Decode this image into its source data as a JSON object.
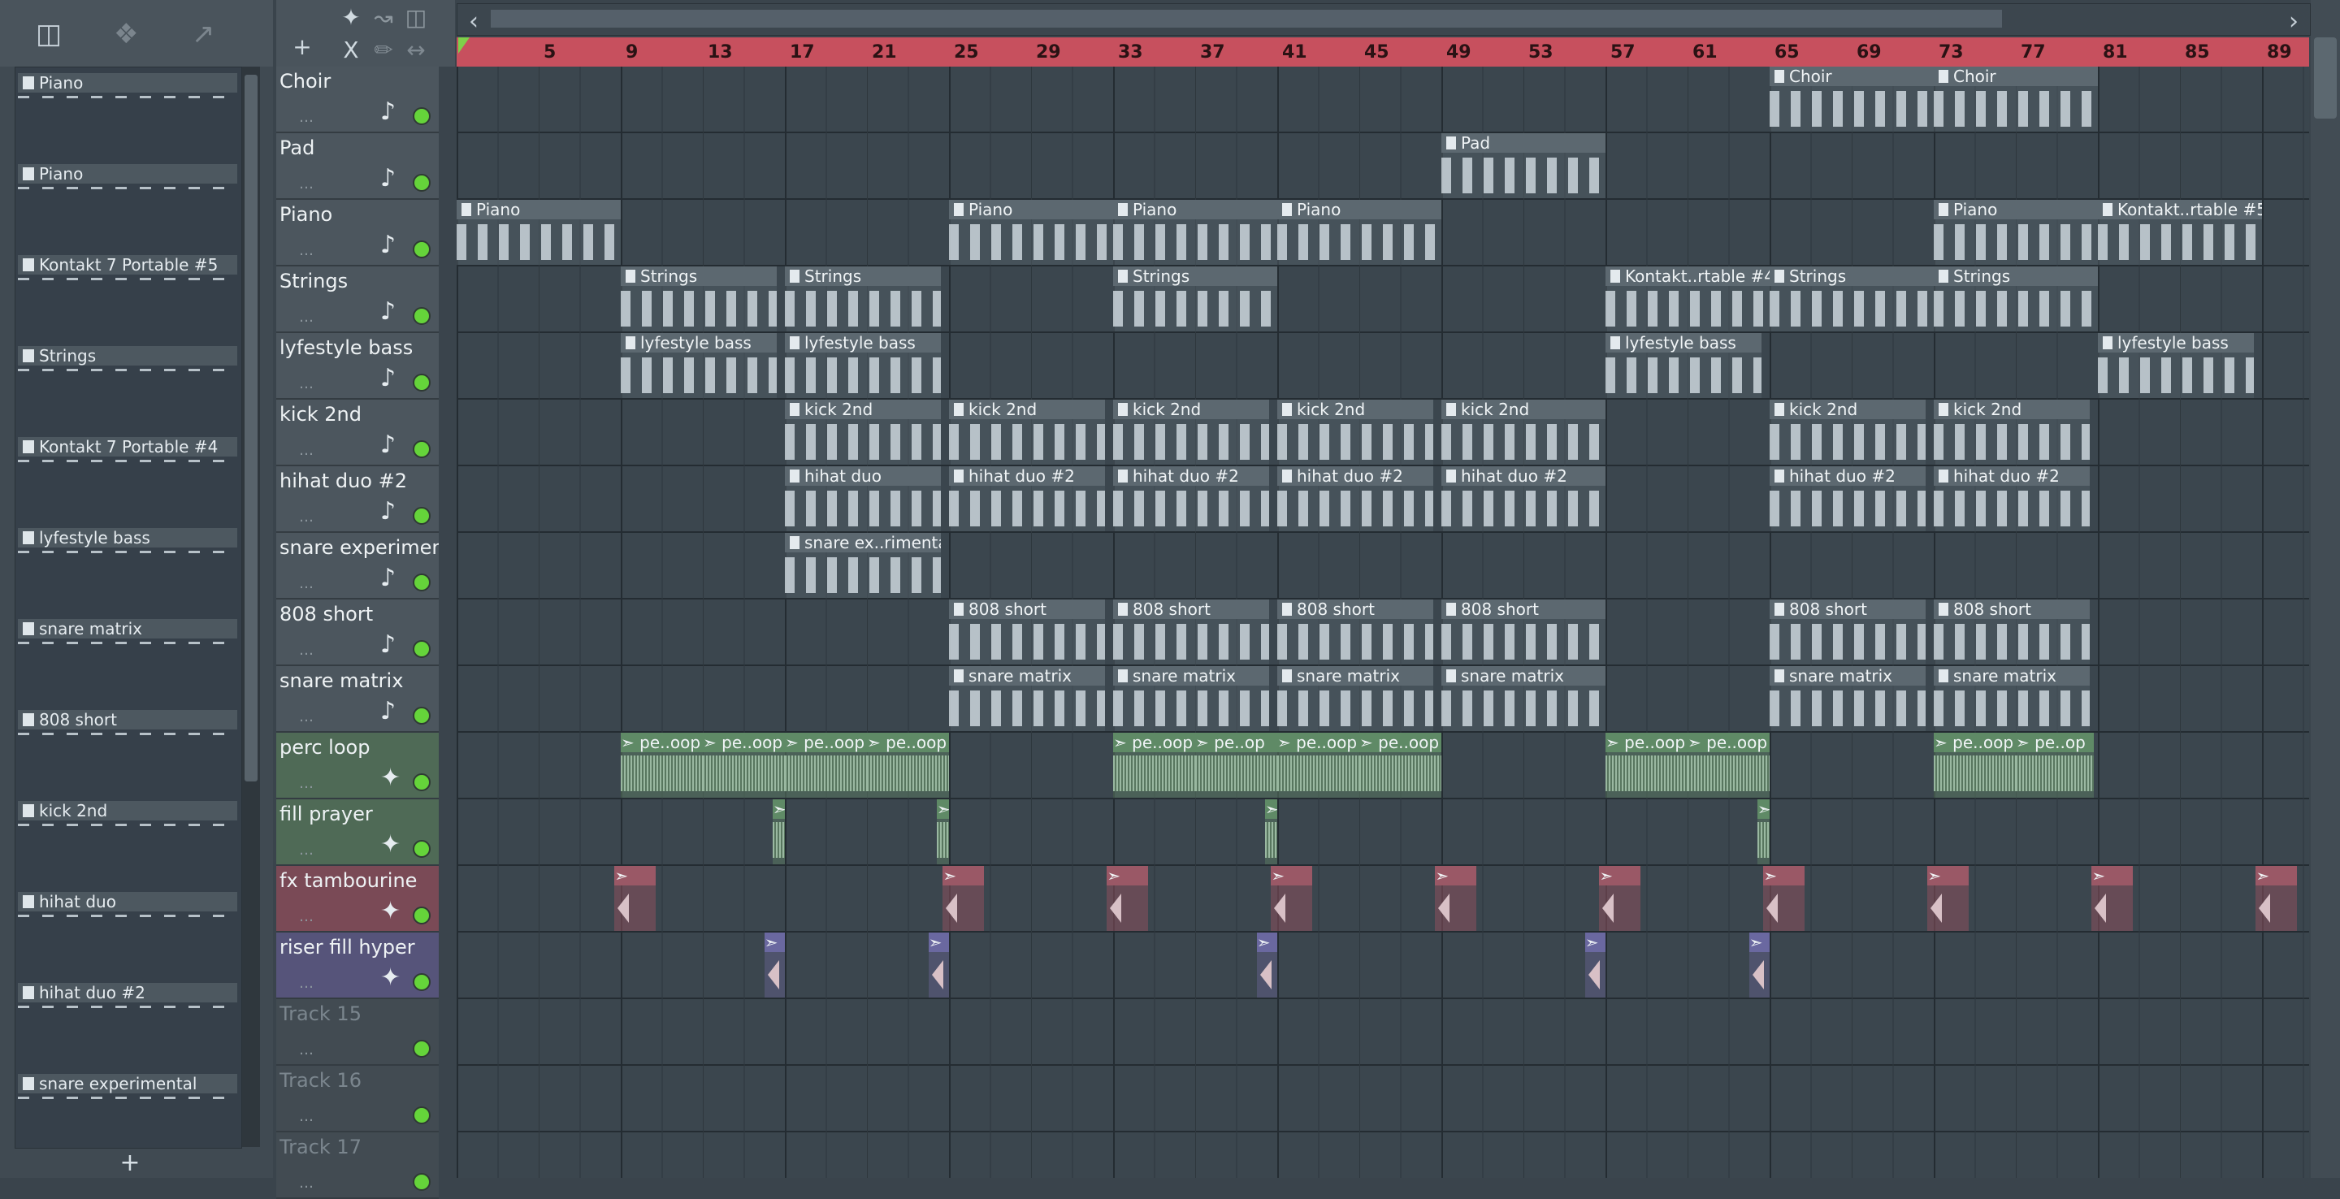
{
  "browser": {
    "patterns": [
      {
        "label": "Piano"
      },
      {
        "label": "Piano"
      },
      {
        "label": "Kontakt 7 Portable #5"
      },
      {
        "label": "Strings"
      },
      {
        "label": "Kontakt 7 Portable #4"
      },
      {
        "label": "lyfestyle bass"
      },
      {
        "label": "snare matrix"
      },
      {
        "label": "808 short"
      },
      {
        "label": "kick 2nd"
      },
      {
        "label": "hihat duo"
      },
      {
        "label": "hihat duo #2"
      },
      {
        "label": "snare experimental"
      }
    ],
    "add_label": "+",
    "toolbar_icons": [
      "piano-roll-icon",
      "audio-icon",
      "automation-icon"
    ]
  },
  "toolbar": {
    "add_label": "+",
    "close_label": "X"
  },
  "ruler": {
    "bars": [
      "5",
      "9",
      "13",
      "17",
      "21",
      "25",
      "29",
      "33",
      "37",
      "41",
      "45",
      "49",
      "53",
      "57",
      "61",
      "65",
      "69",
      "73",
      "77",
      "81",
      "85",
      "89"
    ]
  },
  "tracks": [
    {
      "name": "Choir",
      "kind": "pattern"
    },
    {
      "name": "Pad",
      "kind": "pattern"
    },
    {
      "name": "Piano",
      "kind": "pattern"
    },
    {
      "name": "Strings",
      "kind": "pattern"
    },
    {
      "name": "lyfestyle bass",
      "kind": "pattern"
    },
    {
      "name": "kick 2nd",
      "kind": "pattern"
    },
    {
      "name": "hihat duo #2",
      "kind": "pattern"
    },
    {
      "name": "snare experiment..",
      "kind": "pattern"
    },
    {
      "name": "808 short",
      "kind": "pattern"
    },
    {
      "name": "snare matrix",
      "kind": "pattern"
    },
    {
      "name": "perc loop",
      "kind": "audio"
    },
    {
      "name": "fill prayer",
      "kind": "audio"
    },
    {
      "name": "fx tambourine",
      "kind": "fx"
    },
    {
      "name": "riser fill hyper",
      "kind": "riser"
    },
    {
      "name": "Track 15",
      "kind": "empty"
    },
    {
      "name": "Track 16",
      "kind": "empty"
    },
    {
      "name": "Track 17",
      "kind": "empty"
    }
  ],
  "clips": [
    {
      "track": 0,
      "bar": 65,
      "len": 8,
      "label": "Choir",
      "kind": "pattern"
    },
    {
      "track": 0,
      "bar": 73,
      "len": 8,
      "label": "Choir",
      "kind": "pattern"
    },
    {
      "track": 1,
      "bar": 49,
      "len": 8,
      "label": "Pad",
      "kind": "pattern"
    },
    {
      "track": 2,
      "bar": 1,
      "len": 8,
      "label": "Piano",
      "kind": "pattern"
    },
    {
      "track": 2,
      "bar": 25,
      "len": 8,
      "label": "Piano",
      "kind": "pattern"
    },
    {
      "track": 2,
      "bar": 33,
      "len": 8,
      "label": "Piano",
      "kind": "pattern"
    },
    {
      "track": 2,
      "bar": 41,
      "len": 8,
      "label": "Piano",
      "kind": "pattern"
    },
    {
      "track": 2,
      "bar": 73,
      "len": 8,
      "label": "Piano",
      "kind": "pattern"
    },
    {
      "track": 2,
      "bar": 81,
      "len": 8,
      "label": "Kontakt..rtable #5",
      "kind": "pattern"
    },
    {
      "track": 3,
      "bar": 9,
      "len": 7.6,
      "label": "Strings",
      "kind": "pattern"
    },
    {
      "track": 3,
      "bar": 17,
      "len": 7.6,
      "label": "Strings",
      "kind": "pattern"
    },
    {
      "track": 3,
      "bar": 33,
      "len": 8,
      "label": "Strings",
      "kind": "pattern"
    },
    {
      "track": 3,
      "bar": 57,
      "len": 8,
      "label": "Kontakt..rtable #4",
      "kind": "pattern"
    },
    {
      "track": 3,
      "bar": 65,
      "len": 8,
      "label": "Strings",
      "kind": "pattern"
    },
    {
      "track": 3,
      "bar": 73,
      "len": 8,
      "label": "Strings",
      "kind": "pattern"
    },
    {
      "track": 4,
      "bar": 9,
      "len": 7.6,
      "label": "lyfestyle bass",
      "kind": "pattern"
    },
    {
      "track": 4,
      "bar": 17,
      "len": 7.6,
      "label": "lyfestyle bass",
      "kind": "pattern"
    },
    {
      "track": 4,
      "bar": 57,
      "len": 7.6,
      "label": "lyfestyle bass",
      "kind": "pattern"
    },
    {
      "track": 4,
      "bar": 81,
      "len": 7.6,
      "label": "lyfestyle bass",
      "kind": "pattern"
    },
    {
      "track": 5,
      "bar": 17,
      "len": 7.6,
      "label": "kick 2nd",
      "kind": "pattern"
    },
    {
      "track": 5,
      "bar": 25,
      "len": 7.6,
      "label": "kick 2nd",
      "kind": "pattern"
    },
    {
      "track": 5,
      "bar": 33,
      "len": 7.6,
      "label": "kick 2nd",
      "kind": "pattern"
    },
    {
      "track": 5,
      "bar": 41,
      "len": 7.6,
      "label": "kick 2nd",
      "kind": "pattern"
    },
    {
      "track": 5,
      "bar": 49,
      "len": 8,
      "label": "kick 2nd",
      "kind": "pattern"
    },
    {
      "track": 5,
      "bar": 65,
      "len": 7.6,
      "label": "kick 2nd",
      "kind": "pattern"
    },
    {
      "track": 5,
      "bar": 73,
      "len": 7.6,
      "label": "kick 2nd",
      "kind": "pattern"
    },
    {
      "track": 6,
      "bar": 17,
      "len": 7.6,
      "label": "hihat duo",
      "kind": "pattern"
    },
    {
      "track": 6,
      "bar": 25,
      "len": 7.6,
      "label": "hihat duo #2",
      "kind": "pattern"
    },
    {
      "track": 6,
      "bar": 33,
      "len": 7.6,
      "label": "hihat duo #2",
      "kind": "pattern"
    },
    {
      "track": 6,
      "bar": 41,
      "len": 7.6,
      "label": "hihat duo #2",
      "kind": "pattern"
    },
    {
      "track": 6,
      "bar": 49,
      "len": 8,
      "label": "hihat duo #2",
      "kind": "pattern"
    },
    {
      "track": 6,
      "bar": 65,
      "len": 7.6,
      "label": "hihat duo #2",
      "kind": "pattern"
    },
    {
      "track": 6,
      "bar": 73,
      "len": 7.6,
      "label": "hihat duo #2",
      "kind": "pattern"
    },
    {
      "track": 7,
      "bar": 17,
      "len": 7.6,
      "label": "snare ex..rimental",
      "kind": "pattern"
    },
    {
      "track": 8,
      "bar": 25,
      "len": 7.6,
      "label": "808 short",
      "kind": "pattern"
    },
    {
      "track": 8,
      "bar": 33,
      "len": 7.6,
      "label": "808 short",
      "kind": "pattern"
    },
    {
      "track": 8,
      "bar": 41,
      "len": 7.6,
      "label": "808 short",
      "kind": "pattern"
    },
    {
      "track": 8,
      "bar": 49,
      "len": 8,
      "label": "808 short",
      "kind": "pattern"
    },
    {
      "track": 8,
      "bar": 65,
      "len": 7.6,
      "label": "808 short",
      "kind": "pattern"
    },
    {
      "track": 8,
      "bar": 73,
      "len": 7.6,
      "label": "808 short",
      "kind": "pattern"
    },
    {
      "track": 9,
      "bar": 25,
      "len": 7.6,
      "label": "snare matrix",
      "kind": "pattern"
    },
    {
      "track": 9,
      "bar": 33,
      "len": 7.6,
      "label": "snare matrix",
      "kind": "pattern"
    },
    {
      "track": 9,
      "bar": 41,
      "len": 7.6,
      "label": "snare matrix",
      "kind": "pattern"
    },
    {
      "track": 9,
      "bar": 49,
      "len": 8,
      "label": "snare matrix",
      "kind": "pattern"
    },
    {
      "track": 9,
      "bar": 65,
      "len": 7.6,
      "label": "snare matrix",
      "kind": "pattern"
    },
    {
      "track": 9,
      "bar": 73,
      "len": 7.6,
      "label": "snare matrix",
      "kind": "pattern"
    },
    {
      "track": 10,
      "bar": 9,
      "len": 4,
      "label": "pe..oop",
      "kind": "audio"
    },
    {
      "track": 10,
      "bar": 13,
      "len": 4,
      "label": "pe..oop",
      "kind": "audio"
    },
    {
      "track": 10,
      "bar": 17,
      "len": 4,
      "label": "pe..oop",
      "kind": "audio"
    },
    {
      "track": 10,
      "bar": 21,
      "len": 4,
      "label": "pe..oop",
      "kind": "audio"
    },
    {
      "track": 10,
      "bar": 33,
      "len": 4,
      "label": "pe..oop",
      "kind": "audio"
    },
    {
      "track": 10,
      "bar": 37,
      "len": 4,
      "label": "pe..op",
      "kind": "audio"
    },
    {
      "track": 10,
      "bar": 41,
      "len": 4,
      "label": "pe..oop",
      "kind": "audio"
    },
    {
      "track": 10,
      "bar": 45,
      "len": 4,
      "label": "pe..oop",
      "kind": "audio"
    },
    {
      "track": 10,
      "bar": 57,
      "len": 4,
      "label": "pe..oop",
      "kind": "audio"
    },
    {
      "track": 10,
      "bar": 61,
      "len": 4,
      "label": "pe..oop",
      "kind": "audio"
    },
    {
      "track": 10,
      "bar": 73,
      "len": 4,
      "label": "pe..oop",
      "kind": "audio"
    },
    {
      "track": 10,
      "bar": 77,
      "len": 3.8,
      "label": "pe..op",
      "kind": "audio"
    },
    {
      "track": 11,
      "bar": 16.4,
      "len": 0.6,
      "label": "",
      "kind": "audio"
    },
    {
      "track": 11,
      "bar": 24.4,
      "len": 0.6,
      "label": "",
      "kind": "audio"
    },
    {
      "track": 11,
      "bar": 40.4,
      "len": 0.6,
      "label": "",
      "kind": "audio"
    },
    {
      "track": 11,
      "bar": 64.4,
      "len": 0.6,
      "label": "",
      "kind": "audio"
    },
    {
      "track": 12,
      "bar": 8.7,
      "len": 2,
      "label": "",
      "kind": "fx"
    },
    {
      "track": 12,
      "bar": 24.7,
      "len": 2,
      "label": "",
      "kind": "fx"
    },
    {
      "track": 12,
      "bar": 32.7,
      "len": 2,
      "label": "",
      "kind": "fx"
    },
    {
      "track": 12,
      "bar": 40.7,
      "len": 2,
      "label": "",
      "kind": "fx"
    },
    {
      "track": 12,
      "bar": 48.7,
      "len": 2,
      "label": "",
      "kind": "fx"
    },
    {
      "track": 12,
      "bar": 56.7,
      "len": 2,
      "label": "",
      "kind": "fx"
    },
    {
      "track": 12,
      "bar": 64.7,
      "len": 2,
      "label": "",
      "kind": "fx"
    },
    {
      "track": 12,
      "bar": 72.7,
      "len": 2,
      "label": "",
      "kind": "fx"
    },
    {
      "track": 12,
      "bar": 80.7,
      "len": 2,
      "label": "",
      "kind": "fx"
    },
    {
      "track": 12,
      "bar": 88.7,
      "len": 2,
      "label": "",
      "kind": "fx"
    },
    {
      "track": 13,
      "bar": 16,
      "len": 1,
      "label": "",
      "kind": "riser"
    },
    {
      "track": 13,
      "bar": 24,
      "len": 1,
      "label": "",
      "kind": "riser"
    },
    {
      "track": 13,
      "bar": 40,
      "len": 1,
      "label": "",
      "kind": "riser"
    },
    {
      "track": 13,
      "bar": 56,
      "len": 1,
      "label": "",
      "kind": "riser"
    },
    {
      "track": 13,
      "bar": 64,
      "len": 1,
      "label": "",
      "kind": "riser"
    }
  ],
  "colors": {
    "ruler": "#c7505e",
    "play_marker": "#7ed04a",
    "track_led": "#65d43a",
    "audio_clip": "#5f8a66",
    "fx_clip": "#9a5866",
    "riser_clip": "#6a68a0"
  }
}
